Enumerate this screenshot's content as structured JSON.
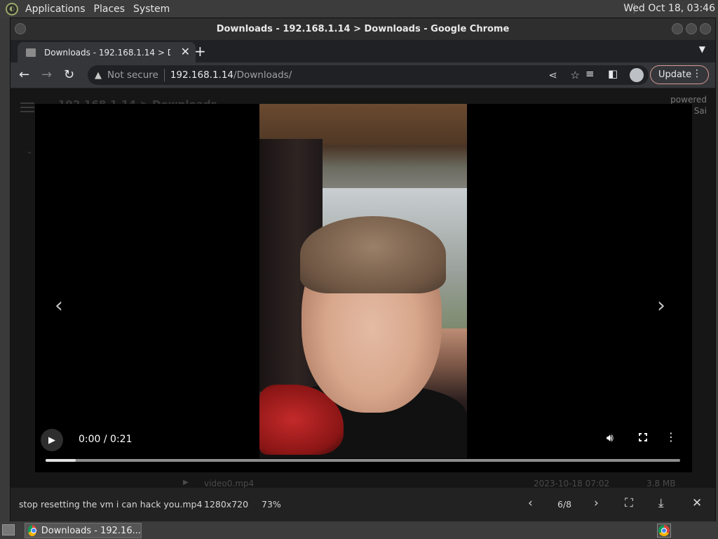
{
  "desktop": {
    "menus": [
      "Applications",
      "Places",
      "System"
    ],
    "clock": "Wed Oct 18, 03:46"
  },
  "window": {
    "title": "Downloads - 192.168.1.14 > Downloads - Google Chrome"
  },
  "tab": {
    "title": "Downloads - 192.168.1.14 > Do",
    "close_glyph": "✕",
    "new_tab_glyph": "+"
  },
  "omnibox": {
    "security_label": "Not secure",
    "url_host": "192.168.1.14",
    "url_path": "/Downloads/"
  },
  "toolbar": {
    "update_label": "Update"
  },
  "page_background": {
    "breadcrumb": "192.168.1.14 > Downloads",
    "powered_line1": "powered",
    "powered_line2": "Sai"
  },
  "video_player": {
    "time": "0:00 / 0:21",
    "progress_fraction": 0.047
  },
  "file_row": {
    "name": "video0.mp4",
    "date": "2023-10-18 07:02",
    "size": "3.8 MB"
  },
  "viewer_bar": {
    "filename": "stop resetting the vm i can hack you.mp4",
    "resolution": "1280x720",
    "zoom": "73%",
    "counter": "6/8"
  },
  "taskbar": {
    "chrome_task_label": "Downloads - 192.16..."
  },
  "colors": {
    "update_border": "#d59c92",
    "page_bg": "#161616",
    "toolbar_bg": "#35363a"
  }
}
